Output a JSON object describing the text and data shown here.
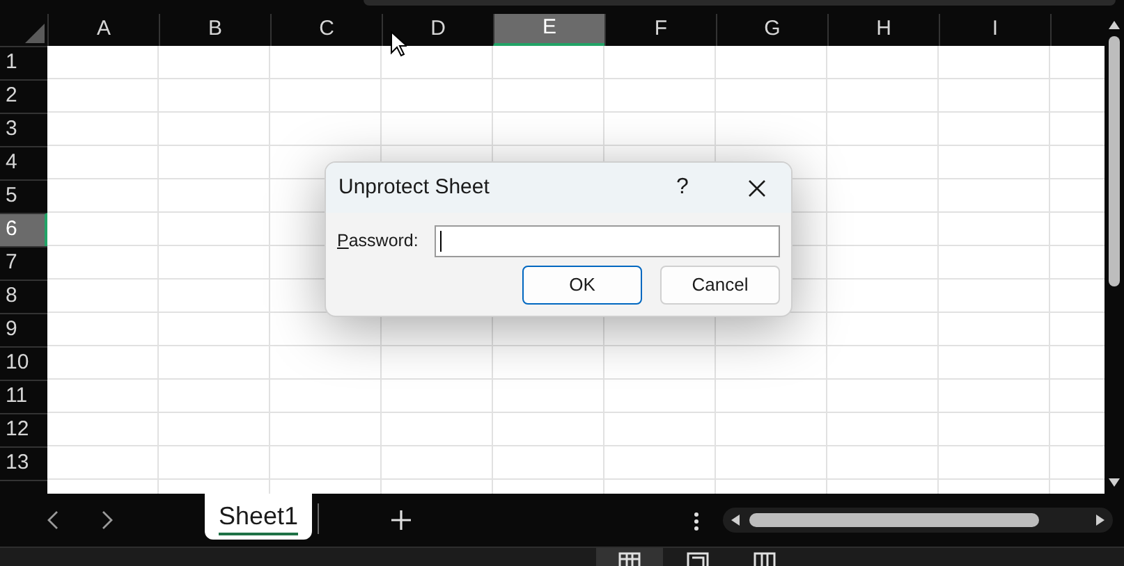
{
  "columns": [
    {
      "label": "A",
      "selected": false
    },
    {
      "label": "B",
      "selected": false
    },
    {
      "label": "C",
      "selected": false
    },
    {
      "label": "D",
      "selected": false
    },
    {
      "label": "E",
      "selected": true
    },
    {
      "label": "F",
      "selected": false
    },
    {
      "label": "G",
      "selected": false
    },
    {
      "label": "H",
      "selected": false
    },
    {
      "label": "I",
      "selected": false
    }
  ],
  "rows": [
    {
      "label": "1",
      "selected": false
    },
    {
      "label": "2",
      "selected": false
    },
    {
      "label": "3",
      "selected": false
    },
    {
      "label": "4",
      "selected": false
    },
    {
      "label": "5",
      "selected": false
    },
    {
      "label": "6",
      "selected": true
    },
    {
      "label": "7",
      "selected": false
    },
    {
      "label": "8",
      "selected": false
    },
    {
      "label": "9",
      "selected": false
    },
    {
      "label": "10",
      "selected": false
    },
    {
      "label": "11",
      "selected": false
    },
    {
      "label": "12",
      "selected": false
    },
    {
      "label": "13",
      "selected": false
    }
  ],
  "dialog": {
    "title": "Unprotect Sheet",
    "help": "?",
    "field_label": "Password:",
    "access_key_underlined": true,
    "buttons": [
      {
        "label": "OK",
        "default": true
      },
      {
        "label": "Cancel",
        "default": false
      }
    ]
  },
  "sheet_tabs": [
    {
      "label": "Sheet1",
      "selected": true
    }
  ]
}
